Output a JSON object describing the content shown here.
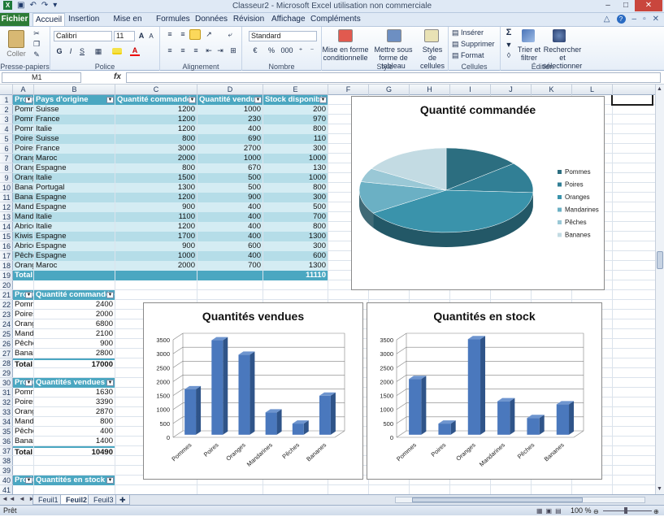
{
  "titlebar": {
    "title": "Classeur2 - Microsoft Excel utilisation non commerciale",
    "min": "–",
    "max": "□",
    "close": "✕"
  },
  "tabs": [
    "Fichier",
    "Accueil",
    "Insertion",
    "Mise en page",
    "Formules",
    "Données",
    "Révision",
    "Affichage",
    "Compléments"
  ],
  "ribbon": {
    "clipboard": {
      "paste": "Coller",
      "label": "Presse-papiers"
    },
    "font": {
      "name": "Calibri",
      "size": "11",
      "bold": "G",
      "italic": "I",
      "underline": "S",
      "grow": "A",
      "shrink": "A",
      "label": "Police"
    },
    "alignment": {
      "label": "Alignement"
    },
    "number": {
      "format": "Standard",
      "percent": "%",
      "thousands": "000",
      "label": "Nombre"
    },
    "style": {
      "cond": "Mise en forme conditionnelle",
      "table": "Mettre sous forme de tableau",
      "cell": "Styles de cellules",
      "label": "Style"
    },
    "cells": {
      "insert": "Insérer",
      "delete": "Supprimer",
      "format": "Format",
      "label": "Cellules"
    },
    "edit": {
      "sigma": "Σ",
      "sort": "Trier et filtrer",
      "find": "Rechercher et sélectionner",
      "label": "Édition"
    }
  },
  "formula_bar": {
    "name_box": "M1",
    "fx": "fx",
    "formula": ""
  },
  "columns": [
    "A",
    "B",
    "C",
    "D",
    "E",
    "F",
    "G",
    "H",
    "I",
    "J",
    "K",
    "L"
  ],
  "table1": {
    "headers": [
      "Produit",
      "Pays d'origine",
      "Quantité commandée",
      "Quantité vendue",
      "Stock disponible"
    ],
    "rows": [
      [
        "Pommes",
        "Suisse",
        "1200",
        "1000",
        "200"
      ],
      [
        "Pommes",
        "France",
        "1200",
        "230",
        "970"
      ],
      [
        "Pommes",
        "Italie",
        "1200",
        "400",
        "800"
      ],
      [
        "Poires",
        "Suisse",
        "800",
        "690",
        "110"
      ],
      [
        "Poires",
        "France",
        "3000",
        "2700",
        "300"
      ],
      [
        "Oranges",
        "Maroc",
        "2000",
        "1000",
        "1000"
      ],
      [
        "Oranges",
        "Espagne",
        "800",
        "670",
        "130"
      ],
      [
        "Oranges",
        "Italie",
        "1500",
        "500",
        "1000"
      ],
      [
        "Bananes",
        "Portugal",
        "1300",
        "500",
        "800"
      ],
      [
        "Bananes",
        "Espagne",
        "1200",
        "900",
        "300"
      ],
      [
        "Mandarines",
        "Espagne",
        "900",
        "400",
        "500"
      ],
      [
        "Mandarines",
        "Italie",
        "1100",
        "400",
        "700"
      ],
      [
        "Abricots",
        "Italie",
        "1200",
        "400",
        "800"
      ],
      [
        "Kiwis",
        "Espagne",
        "1700",
        "400",
        "1300"
      ],
      [
        "Abricots",
        "Espagne",
        "900",
        "600",
        "300"
      ],
      [
        "Pêches",
        "Espagne",
        "1000",
        "400",
        "600"
      ],
      [
        "Oranges",
        "Maroc",
        "2000",
        "700",
        "1300"
      ]
    ],
    "total_label": "Total",
    "total_value": "11110"
  },
  "table2": {
    "headers": [
      "Produit",
      "Quantité commandée"
    ],
    "rows": [
      [
        "Pommes",
        "2400"
      ],
      [
        "Poires",
        "2000"
      ],
      [
        "Oranges",
        "6800"
      ],
      [
        "Mandarines",
        "2100"
      ],
      [
        "Pêches",
        "900"
      ],
      [
        "Bananes",
        "2800"
      ]
    ],
    "total_label": "Total",
    "total_value": "17000"
  },
  "table3": {
    "headers": [
      "Produit",
      "Quantités vendues"
    ],
    "rows": [
      [
        "Pommes",
        "1630"
      ],
      [
        "Poires",
        "3390"
      ],
      [
        "Oranges",
        "2870"
      ],
      [
        "Mandarines",
        "800"
      ],
      [
        "Pêches",
        "400"
      ],
      [
        "Bananes",
        "1400"
      ]
    ],
    "total_label": "Total",
    "total_value": "10490"
  },
  "table4": {
    "headers": [
      "Produit",
      "Quantités en stock"
    ]
  },
  "chart_data": [
    {
      "type": "pie",
      "title": "Quantité commandée",
      "categories": [
        "Pommes",
        "Poires",
        "Oranges",
        "Mandarines",
        "Pêches",
        "Bananes"
      ],
      "values": [
        2400,
        2000,
        6800,
        2100,
        900,
        2800
      ],
      "colors": [
        "#2c6e80",
        "#317f95",
        "#3a93ab",
        "#6bb0c4",
        "#9ac8d6",
        "#c3dbe3"
      ],
      "legend": "right"
    },
    {
      "type": "bar",
      "title": "Quantités vendues",
      "categories": [
        "Pommes",
        "Poires",
        "Oranges",
        "Mandarines",
        "Pêches",
        "Bananes"
      ],
      "values": [
        1630,
        3390,
        2870,
        800,
        400,
        1400
      ],
      "ylim": [
        0,
        3500
      ],
      "yticks": [
        "0",
        "500",
        "1000",
        "1500",
        "2000",
        "2500",
        "3000",
        "3500"
      ],
      "grid": true
    },
    {
      "type": "bar",
      "title": "Quantités en stock",
      "categories": [
        "Pommes",
        "Poires",
        "Oranges",
        "Mandarines",
        "Pêches",
        "Bananes"
      ],
      "values": [
        2000,
        400,
        3430,
        1200,
        600,
        1090
      ],
      "ylim": [
        0,
        3500
      ],
      "yticks": [
        "0",
        "500",
        "1000",
        "1500",
        "2000",
        "2500",
        "3000",
        "3500"
      ],
      "grid": true
    }
  ],
  "sheets": [
    "Feuil1",
    "Feuil2",
    "Feuil3"
  ],
  "status": {
    "ready": "Prêt",
    "zoom": "100 %"
  }
}
